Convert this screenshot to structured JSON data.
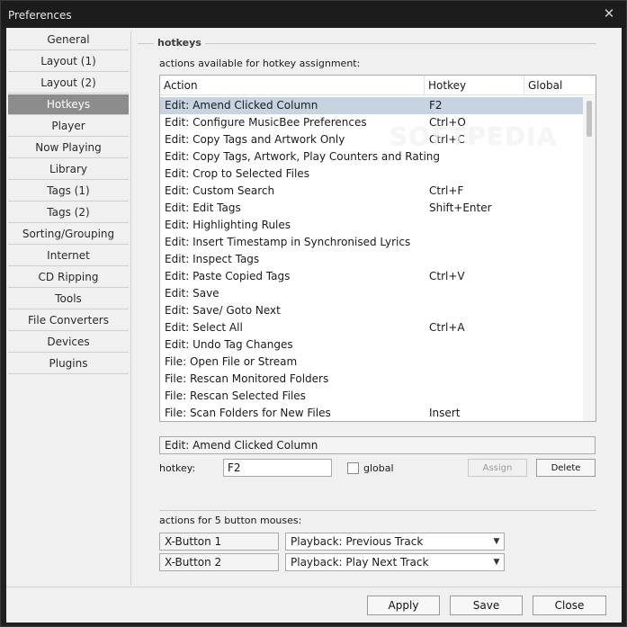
{
  "window": {
    "title": "Preferences",
    "close_glyph": "✕"
  },
  "sidebar": {
    "items": [
      {
        "label": "General"
      },
      {
        "label": "Layout (1)"
      },
      {
        "label": "Layout (2)"
      },
      {
        "label": "Hotkeys",
        "active": true
      },
      {
        "label": "Player"
      },
      {
        "label": "Now Playing"
      },
      {
        "label": "Library"
      },
      {
        "label": "Tags (1)"
      },
      {
        "label": "Tags (2)"
      },
      {
        "label": "Sorting/Grouping"
      },
      {
        "label": "Internet"
      },
      {
        "label": "CD Ripping"
      },
      {
        "label": "Tools"
      },
      {
        "label": "File Converters"
      },
      {
        "label": "Devices"
      },
      {
        "label": "Plugins"
      }
    ]
  },
  "hotkeys": {
    "section_title": "hotkeys",
    "list_caption": "actions available for hotkey assignment:",
    "columns": [
      "Action",
      "Hotkey",
      "Global"
    ],
    "rows": [
      {
        "action": "Edit: Amend Clicked Column",
        "hotkey": "F2",
        "selected": true
      },
      {
        "action": "Edit: Configure MusicBee Preferences",
        "hotkey": "Ctrl+O"
      },
      {
        "action": "Edit: Copy Tags and Artwork Only",
        "hotkey": "Ctrl+C"
      },
      {
        "action": "Edit: Copy Tags, Artwork, Play Counters and Rating",
        "hotkey": ""
      },
      {
        "action": "Edit: Crop to Selected Files",
        "hotkey": ""
      },
      {
        "action": "Edit: Custom Search",
        "hotkey": "Ctrl+F"
      },
      {
        "action": "Edit: Edit Tags",
        "hotkey": "Shift+Enter"
      },
      {
        "action": "Edit: Highlighting Rules",
        "hotkey": ""
      },
      {
        "action": "Edit: Insert Timestamp in Synchronised Lyrics",
        "hotkey": ""
      },
      {
        "action": "Edit: Inspect Tags",
        "hotkey": ""
      },
      {
        "action": "Edit: Paste Copied Tags",
        "hotkey": "Ctrl+V"
      },
      {
        "action": "Edit: Save",
        "hotkey": ""
      },
      {
        "action": "Edit: Save/ Goto Next",
        "hotkey": ""
      },
      {
        "action": "Edit: Select All",
        "hotkey": "Ctrl+A"
      },
      {
        "action": "Edit: Undo Tag Changes",
        "hotkey": ""
      },
      {
        "action": "File: Open File or Stream",
        "hotkey": ""
      },
      {
        "action": "File: Rescan Monitored Folders",
        "hotkey": ""
      },
      {
        "action": "File: Rescan Selected Files",
        "hotkey": ""
      },
      {
        "action": "File: Scan Folders for New Files",
        "hotkey": "Insert"
      }
    ],
    "selected_action": "Edit: Amend Clicked Column",
    "hotkey_label": "hotkey:",
    "hotkey_value": "F2",
    "global_label": "global",
    "global_checked": false,
    "assign_label": "Assign",
    "delete_label": "Delete"
  },
  "mouse": {
    "caption": "actions for 5 button mouses:",
    "mappings": [
      {
        "button": "X-Button 1",
        "action": "Playback: Previous Track"
      },
      {
        "button": "X-Button 2",
        "action": "Playback: Play Next Track"
      }
    ]
  },
  "footer": {
    "apply": "Apply",
    "save": "Save",
    "close": "Close"
  },
  "watermark": "SOFTPEDIA",
  "icons": {
    "dropdown_arrow": "▼",
    "close": "close-icon"
  }
}
